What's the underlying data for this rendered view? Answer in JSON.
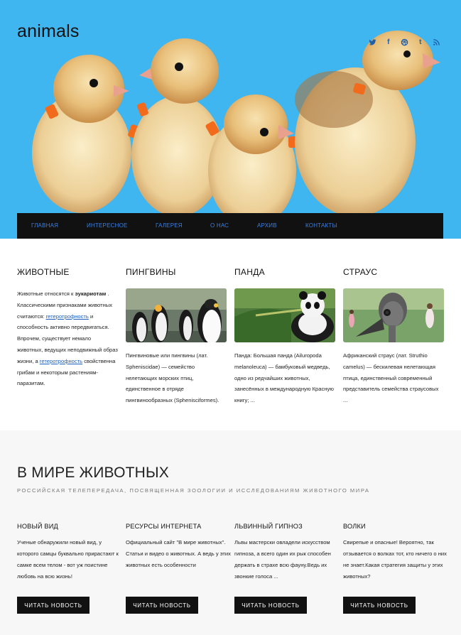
{
  "site": {
    "title": "animals"
  },
  "social": {
    "icons": [
      "twitter-icon",
      "facebook-icon",
      "dribbble-icon",
      "tumblr-icon",
      "rss-icon"
    ],
    "color": "#1f5fa8"
  },
  "colors": {
    "sky": "#3fb6ef",
    "nav_bg": "#111111",
    "nav_link": "#3c7fe0",
    "link": "#1a5fbf"
  },
  "nav": {
    "items": [
      "ГЛАВНАЯ",
      "ИНТЕРЕСНОЕ",
      "ГАЛЕРЕЯ",
      "О НАС",
      "АРХИВ",
      "КОНТАКТЫ"
    ]
  },
  "cards": [
    {
      "title": "ЖИВОТНЫЕ",
      "p1": "Животные относятся к ",
      "b1": "эукариотам",
      "p2": " . Классическими признаками животных считаются: ",
      "link1": "гетеротрофность",
      "p3": " и способность активно передвигаться. Впрочем, существует немало животных, ведущих неподвижный образ жизни, а ",
      "link2": "гетеротрофность",
      "p4": " свойственна грибам и некоторым растениям-паразитам."
    },
    {
      "title": "ПИНГВИНЫ",
      "text": "Пингвиновые или пингвины (лат. Spheniscidae) — семейство нелетающих морских птиц, единственное в отряде пингвинообразных (Sphenisciformes)."
    },
    {
      "title": "ПАНДА",
      "text": "Панда: Большая панда (Ailuropoda melanoleuca) — бамбуковый медведь, одно из редчайших животных, занесённых в международную Красную книгу; ..."
    },
    {
      "title": "СТРАУС",
      "text": "Африканский страус (лат. Struthio camelus) — бескилевая нелетающая птица, единственный современный представитель семейства страусовых ..."
    }
  ],
  "world": {
    "title": "В МИРЕ ЖИВОТНЫХ",
    "subtitle": "РОССИЙСКАЯ ТЕЛЕПЕРЕДАЧА, ПОСВЯЩЕННАЯ ЗООЛОГИИ И ИССЛЕДОВАНИЯМ ЖИВОТНОГО МИРА",
    "news": [
      {
        "title": "НОВЫЙ ВИД",
        "text": "Ученые обнаружили новый вид, у которого самцы буквально прирастают к самке всем телом - вот уж поистине любовь на всю жизнь!",
        "button": "ЧИТАТЬ НОВОСТЬ"
      },
      {
        "title": "РЕСУРСЫ ИНТЕРНЕТА",
        "text": "Официальный сайт \"В мире животных\". Статьи и видео о животных. А ведь у этих животных есть особенности",
        "button": "ЧИТАТЬ НОВОСТЬ"
      },
      {
        "title": "ЛЬВИННЫЙ ГИПНОЗ",
        "text": "Львы мастерски овладели искусством гипноза, а всего один их рык способен держать в страхе всю фауну.Ведь их звонкие голоса ...",
        "button": "ЧИТАТЬ НОВОСТЬ"
      },
      {
        "title": "ВОЛКИ",
        "text": "Свирепые и опасные! Вероятно, так отзывается о волках тот, кто ничего о них не знает.Какая стратегия защиты у этих животных?",
        "button": "ЧИТАТЬ НОВОСТЬ"
      }
    ]
  }
}
